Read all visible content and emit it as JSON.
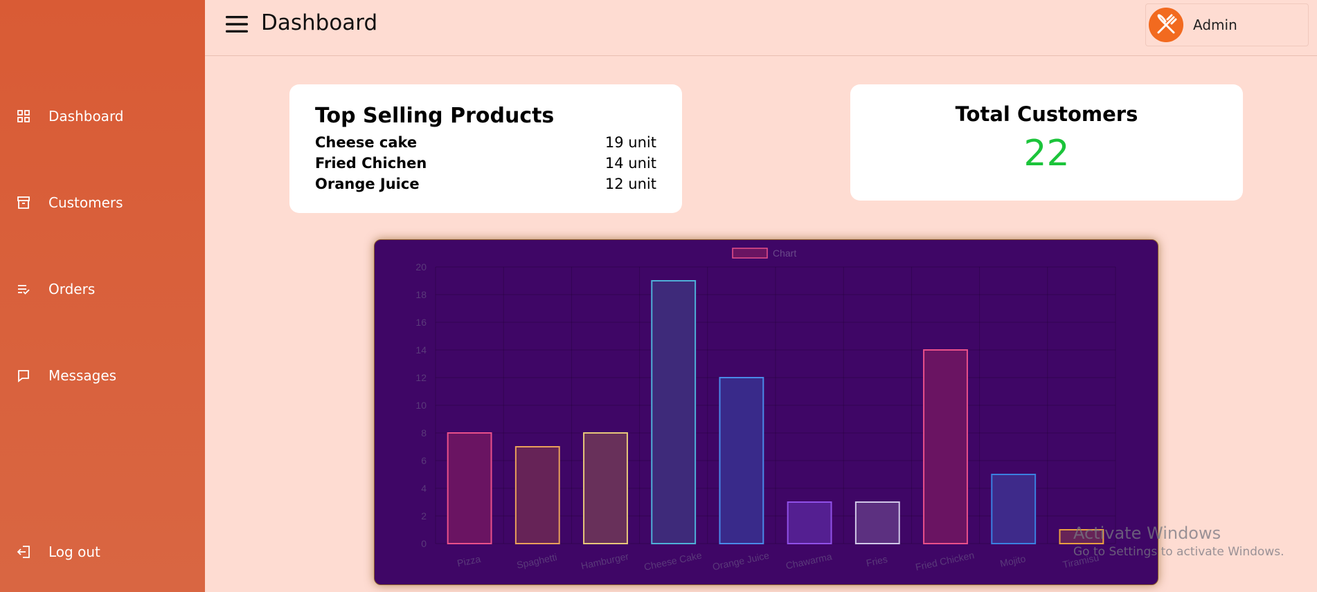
{
  "sidebar": {
    "items": [
      {
        "label": "Dashboard",
        "icon": "grid-icon"
      },
      {
        "label": "Customers",
        "icon": "archive-icon"
      },
      {
        "label": "Orders",
        "icon": "list-check-icon"
      },
      {
        "label": "Messages",
        "icon": "message-icon"
      }
    ],
    "logout": {
      "label": "Log out",
      "icon": "logout-icon"
    }
  },
  "header": {
    "title": "Dashboard",
    "user": {
      "name": "Admin",
      "avatar_icon": "fork-knife-icon"
    }
  },
  "top_selling": {
    "title": "Top Selling Products",
    "items": [
      {
        "name": "Cheese cake",
        "qty": "19 unit"
      },
      {
        "name": "Fried Chichen",
        "qty": "14 unit"
      },
      {
        "name": "Orange Juice",
        "qty": "12 unit"
      }
    ]
  },
  "total_customers": {
    "title": "Total Customers",
    "value": "22"
  },
  "chart_data": {
    "type": "bar",
    "legend": {
      "label": "Chart",
      "position": "top"
    },
    "categories": [
      "Pizza",
      "Spaghetti",
      "Hamburger",
      "Cheese Cake",
      "Orange Juice",
      "Chawarma",
      "Fries",
      "Fried Chicken",
      "Mojito",
      "Tiramisu"
    ],
    "values": [
      8,
      7,
      8,
      19,
      12,
      3,
      3,
      14,
      5,
      1
    ],
    "ylim": [
      0,
      20
    ],
    "yticks": [
      0,
      2,
      4,
      6,
      8,
      10,
      12,
      14,
      16,
      18,
      20
    ],
    "grid": true,
    "colors": {
      "fills": [
        "#6a1462",
        "#662357",
        "#68305a",
        "#3e2a7a",
        "#392a8a",
        "#541f91",
        "#5c3080",
        "#6a1462",
        "#3e2a8a",
        "#662357"
      ],
      "borders": [
        "#e9508a",
        "#e9a05a",
        "#e8c87a",
        "#4fb0d8",
        "#4a8ae8",
        "#9050e8",
        "#d0c8e8",
        "#e9508a",
        "#3a80e0",
        "#e9a040"
      ],
      "background": "#3f0666"
    }
  },
  "watermark": {
    "title": "Activate Windows",
    "subtitle": "Go to Settings to activate Windows."
  },
  "colors": {
    "sidebar": "#d95b35",
    "page_bg": "#fedcd2",
    "accent_green": "#1bc43a"
  }
}
